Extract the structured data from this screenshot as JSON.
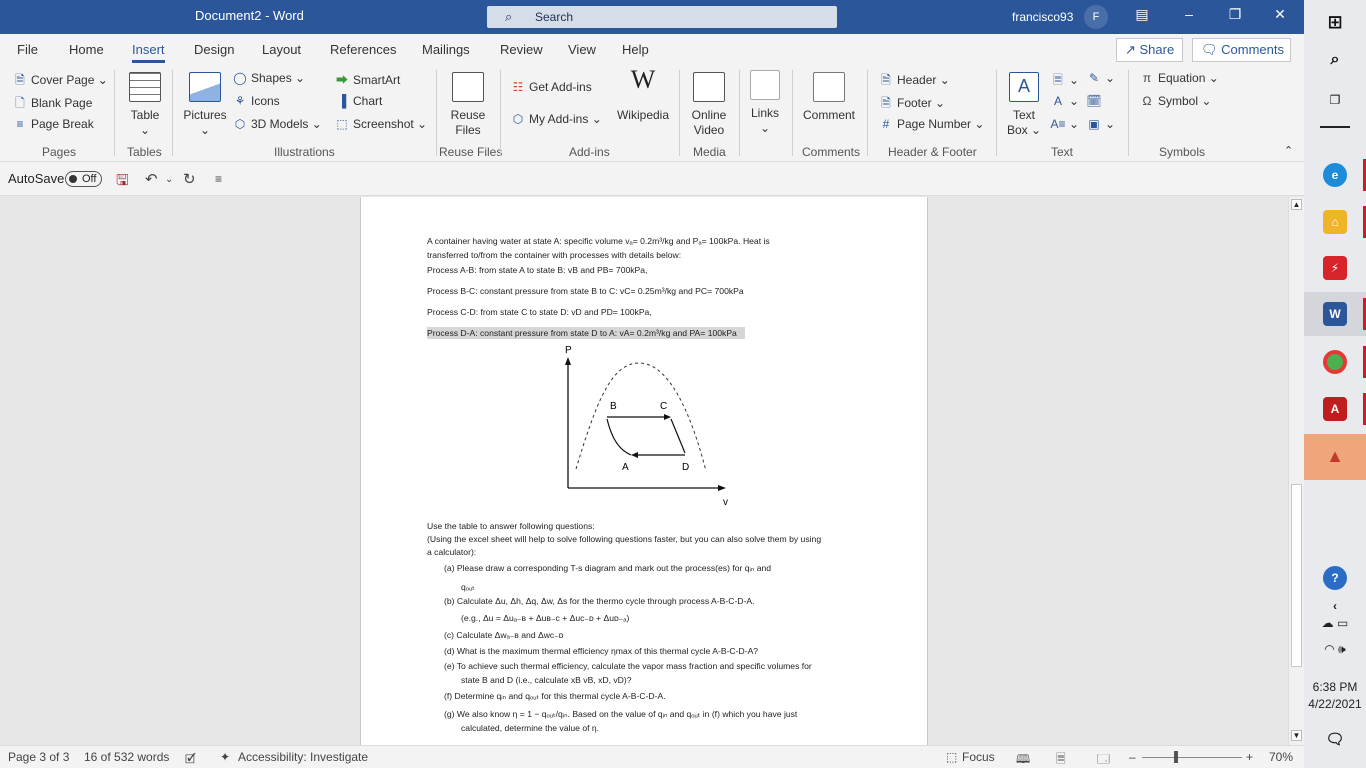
{
  "window": {
    "title": "Document2  -  Word",
    "search_placeholder": "Search",
    "user_name": "francisco93",
    "user_initial": "F"
  },
  "tabs": [
    "File",
    "Home",
    "Insert",
    "Design",
    "Layout",
    "References",
    "Mailings",
    "Review",
    "View",
    "Help"
  ],
  "active_tab": "Insert",
  "share_label": "Share",
  "comments_label": "Comments",
  "ribbon": {
    "pages": {
      "group": "Pages",
      "cover_page": "Cover Page",
      "blank_page": "Blank Page",
      "page_break": "Page Break"
    },
    "tables": {
      "group": "Tables",
      "table": "Table"
    },
    "illustrations": {
      "group": "Illustrations",
      "pictures": "Pictures",
      "shapes": "Shapes",
      "icons": "Icons",
      "models_3d": "3D Models",
      "smartart": "SmartArt",
      "chart": "Chart",
      "screenshot": "Screenshot"
    },
    "reuse": {
      "group": "Reuse Files",
      "reuse_files_l1": "Reuse",
      "reuse_files_l2": "Files"
    },
    "addins": {
      "group": "Add-ins",
      "get_addins": "Get Add-ins",
      "my_addins": "My Add-ins",
      "wikipedia": "Wikipedia"
    },
    "media": {
      "group": "Media",
      "online_video_l1": "Online",
      "online_video_l2": "Video"
    },
    "links": {
      "links": "Links"
    },
    "comments": {
      "group": "Comments",
      "comment": "Comment"
    },
    "header_footer": {
      "group": "Header & Footer",
      "header": "Header",
      "footer": "Footer",
      "page_number": "Page Number"
    },
    "text": {
      "group": "Text",
      "text_box_l1": "Text",
      "text_box_l2": "Box"
    },
    "symbols": {
      "group": "Symbols",
      "equation": "Equation",
      "symbol": "Symbol"
    }
  },
  "qat": {
    "autosave_label": "AutoSave",
    "autosave_state": "Off"
  },
  "document": {
    "intro_1": " A container having water at state A: specific volume vₐ= 0.2m³/kg and Pₐ= 100kPa. Heat is",
    "intro_2": "transferred to/from the container with processes with details below:",
    "process_ab": "Process A-B: from state A to state B: vB and PB= 700kPa,",
    "process_bc": "Process B-C: constant pressure from state B to C: vC= 0.25m³/kg and PC= 700kPa",
    "process_cd": "Process C-D: from state C to state D: vD and PD= 100kPa,",
    "process_da": "Process D-A: constant pressure from state D to A: vA= 0.2m³/kg and PA= 100kPa",
    "diagram": {
      "p_axis": "P",
      "v_axis": "v",
      "a": "A",
      "b": "B",
      "c": "C",
      "d": "D"
    },
    "instructions_1": "Use the table to answer following questions:",
    "instructions_2": "(Using the excel sheet will help to solve following questions faster, but you can also solve them by using",
    "instructions_3": "a calculator):",
    "q_a_1": "(a)  Please draw a corresponding T-s diagram and mark out the process(es) for qᵢₙ and",
    "q_a_2": "qₒᵤₜ",
    "q_b_1": "(b)  Calculate Δu, Δh, Δq, Δw, Δs for the thermo cycle through process A-B-C-D-A.",
    "q_b_2": "(e.g., Δu = Δuₐ₋ʙ + Δuʙ₋ᴄ + Δuᴄ₋ᴅ + Δuᴅ₋ₐ)",
    "q_c": "(c)  Calculate Δwₐ₋ʙ and Δwᴄ₋ᴅ",
    "q_d": "(d)  What is the maximum thermal efficiency ηmax of this thermal cycle A-B-C-D-A?",
    "q_e_1": "(e)  To achieve such thermal efficiency, calculate the vapor mass fraction and specific volumes for",
    "q_e_2": "state B and D (i.e., calculate xB vB, xD, vD)?",
    "q_f": "(f)  Determine qᵢₙ and qₒᵤₜ for this thermal cycle A-B-C-D-A.",
    "q_g_1": "(g)  We also know η = 1 − qₒᵤₜ/qᵢₙ. Based on the value of qᵢₙ and qₒᵤₜ in (f) which you have just",
    "q_g_2": "calculated, determine the value of η."
  },
  "status": {
    "page": "Page 3 of 3",
    "words": "16 of 532 words",
    "accessibility": "Accessibility: Investigate",
    "focus": "Focus",
    "zoom": "70%"
  },
  "taskbar": {
    "time": "6:38 PM",
    "date": "4/22/2021"
  },
  "colors": {
    "word_blue": "#2b579a",
    "highlight": "#d6d6d6"
  }
}
